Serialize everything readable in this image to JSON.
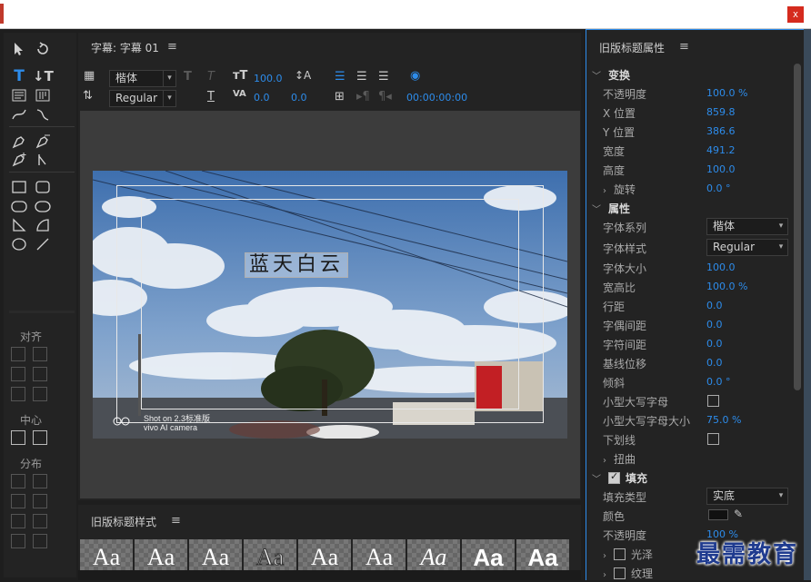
{
  "window": {
    "close_label": "x"
  },
  "tools": {
    "align_label": "对齐",
    "center_label": "中心",
    "distribute_label": "分布"
  },
  "editor": {
    "title": "字幕: 字幕 01",
    "font_family": "楷体",
    "font_style": "Regular",
    "font_size": "100.0",
    "kerning": "0.0",
    "leading": "0.0",
    "timecode": "00:00:00:00",
    "text_content": "蓝天白云",
    "watermark_line1": "Shot on 2.3标准版",
    "watermark_line2": "vivo AI camera"
  },
  "styles": {
    "title": "旧版标题样式",
    "swatch_label": "Aa"
  },
  "properties": {
    "title": "旧版标题属性",
    "transform": {
      "label": "变换",
      "rows": [
        {
          "label": "不透明度",
          "value": "100.0 %"
        },
        {
          "label": "X 位置",
          "value": "859.8"
        },
        {
          "label": "Y 位置",
          "value": "386.6"
        },
        {
          "label": "宽度",
          "value": "491.2"
        },
        {
          "label": "高度",
          "value": "100.0"
        }
      ],
      "rotation_label": "旋转",
      "rotation_value": "0.0 °"
    },
    "attributes": {
      "label": "属性",
      "font_family_label": "字体系列",
      "font_family_value": "楷体",
      "font_style_label": "字体样式",
      "font_style_value": "Regular",
      "rows": [
        {
          "label": "字体大小",
          "value": "100.0"
        },
        {
          "label": "宽高比",
          "value": "100.0 %"
        },
        {
          "label": "行距",
          "value": "0.0"
        },
        {
          "label": "字偶间距",
          "value": "0.0"
        },
        {
          "label": "字符间距",
          "value": "0.0"
        },
        {
          "label": "基线位移",
          "value": "0.0"
        },
        {
          "label": "倾斜",
          "value": "0.0 °"
        }
      ],
      "small_caps_label": "小型大写字母",
      "small_caps_size_label": "小型大写字母大小",
      "small_caps_size_value": "75.0 %",
      "underline_label": "下划线",
      "distort_label": "扭曲"
    },
    "fill": {
      "label": "填充",
      "fill_type_label": "填充类型",
      "fill_type_value": "实底",
      "color_label": "颜色",
      "opacity_label": "不透明度",
      "opacity_value": "100 %",
      "sheen_label": "光泽",
      "texture_label": "纹理"
    }
  },
  "logo": "最需教育",
  "colors": {
    "accent": "#2d8ceb",
    "panel": "#232323",
    "canvas": "#3c3c3c"
  }
}
